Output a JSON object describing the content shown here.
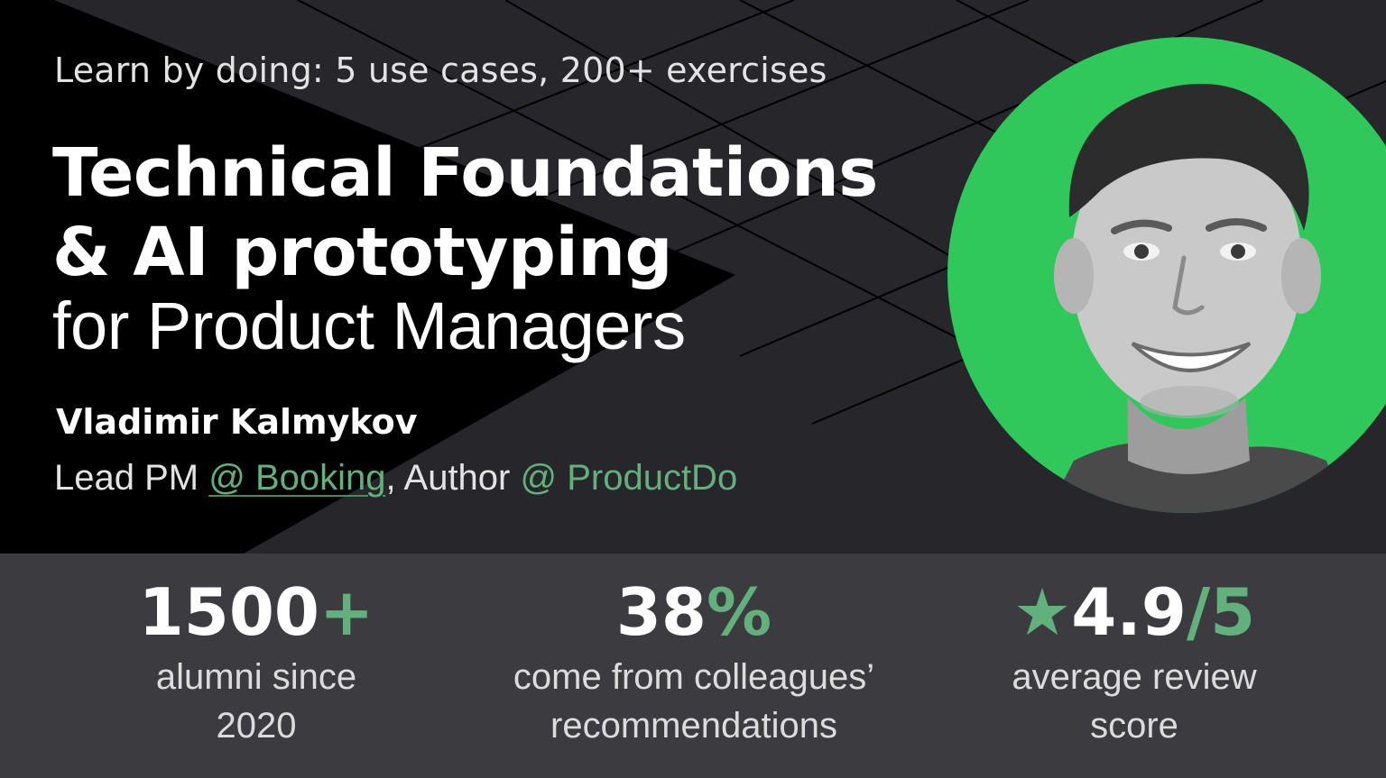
{
  "tagline": "Learn by doing: 5 use cases, 200+ exercises",
  "title": {
    "line1": "Technical Foundations",
    "line2": "& AI prototyping",
    "line3": "for Product Managers"
  },
  "author": {
    "name": "Vladimir Kalmykov",
    "role_prefix": "Lead PM ",
    "company_link": "@ Booking",
    "separator": ", Author ",
    "site_link": "@ ProductDo"
  },
  "stats": [
    {
      "value": "1500",
      "suffix": "+",
      "label_line1": "alumni since",
      "label_line2": "2020"
    },
    {
      "value": "38",
      "suffix": "%",
      "label_line1": "come from colleagues’",
      "label_line2": "recommendations"
    },
    {
      "prefix": "★",
      "value": "4.9",
      "suffix": "/5",
      "label_line1": "average review",
      "label_line2": "score"
    }
  ],
  "colors": {
    "background": "#26262b",
    "accent": "#62b07c",
    "portrait_bg": "#2ec95a",
    "stats_bar": "#3b3b40"
  },
  "icons": [
    "star-icon"
  ]
}
